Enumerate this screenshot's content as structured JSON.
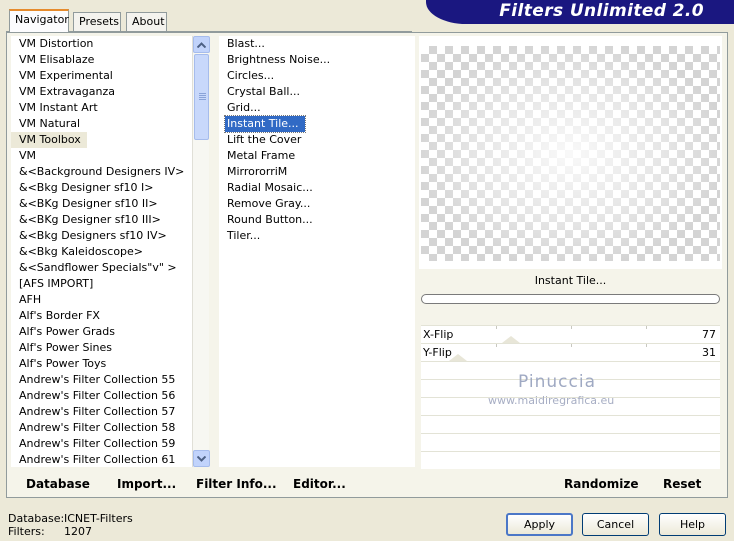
{
  "tabs": [
    "Navigator",
    "Presets",
    "About"
  ],
  "banner_title": "Filters Unlimited 2.0",
  "categories": [
    "VM Distortion",
    "VM Elisablaze",
    "VM Experimental",
    "VM Extravaganza",
    "VM Instant Art",
    "VM Natural",
    "VM Toolbox",
    "VM",
    "&<Background Designers IV>",
    "&<Bkg Designer sf10 I>",
    "&<BKg Designer sf10 II>",
    "&<BKg Designer sf10 III>",
    "&<Bkg Designers sf10 IV>",
    "&<Bkg Kaleidoscope>",
    "&<Sandflower Specials\"v\" >",
    "[AFS IMPORT]",
    "AFH",
    "Alf's Border FX",
    "Alf's Power Grads",
    "Alf's Power Sines",
    "Alf's Power Toys",
    "Andrew's Filter Collection 55",
    "Andrew's Filter Collection 56",
    "Andrew's Filter Collection 57",
    "Andrew's Filter Collection 58",
    "Andrew's Filter Collection 59",
    "Andrew's Filter Collection 61"
  ],
  "selected_category": "VM Toolbox",
  "filters": [
    "Blast...",
    "Brightness Noise...",
    "Circles...",
    "Crystal Ball...",
    "Grid...",
    "Instant Tile...",
    "Lift the Cover",
    "Metal Frame",
    "MirrororriM",
    "Radial Mosaic...",
    "Remove Gray...",
    "Round Button...",
    "Tiler..."
  ],
  "selected_filter": "Instant Tile...",
  "current_filter_label": "Instant Tile...",
  "params": [
    {
      "name": "X-Flip",
      "value": "77"
    },
    {
      "name": "Y-Flip",
      "value": "31"
    }
  ],
  "watermark": {
    "name": "Pinuccia",
    "url": "www.maidiregrafica.eu"
  },
  "bottom_links": {
    "database": "Database",
    "import": "Import...",
    "filter_info": "Filter Info...",
    "editor": "Editor...",
    "randomize": "Randomize",
    "reset": "Reset"
  },
  "status": {
    "database_label": "Database:",
    "database_value": "ICNET-Filters",
    "filters_label": "Filters:",
    "filters_value": "1207"
  },
  "buttons": {
    "apply": "Apply",
    "cancel": "Cancel",
    "help": "Help"
  },
  "colors": {
    "banner": "#1a1780",
    "selection": "#316ac5",
    "tab_highlight": "#e68b2c"
  },
  "icons": {
    "scroll_up": "chevron-up-icon",
    "scroll_down": "chevron-down-icon"
  }
}
